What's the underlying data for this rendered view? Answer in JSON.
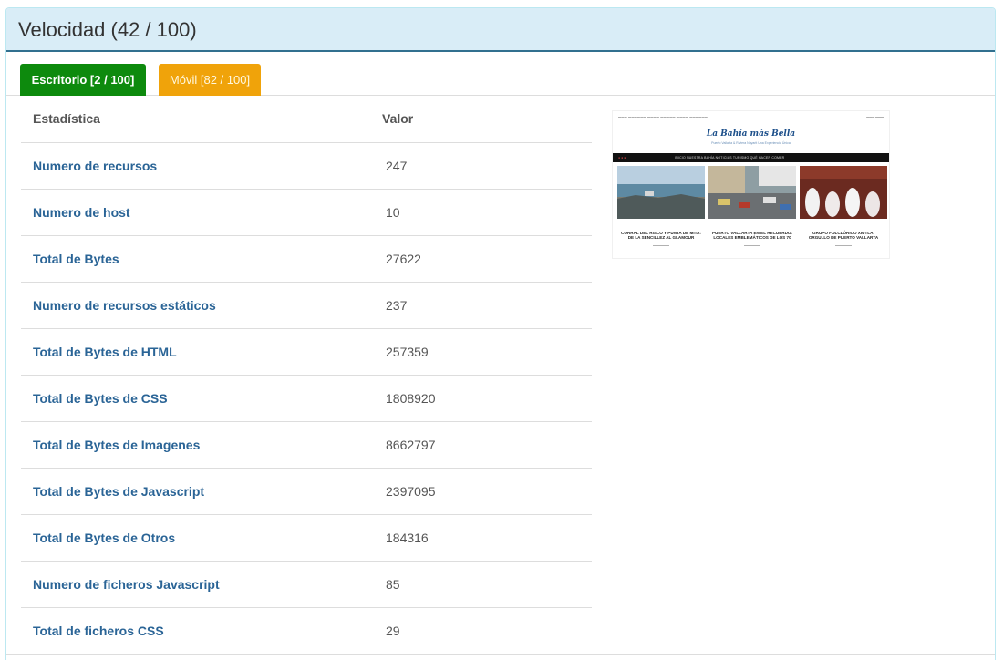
{
  "panel": {
    "title": "Velocidad (42 / 100)"
  },
  "tabs": [
    {
      "label": "Escritorio [2 / 100]"
    },
    {
      "label": "Móvil [82 / 100]"
    }
  ],
  "table": {
    "headers": {
      "stat": "Estadística",
      "value": "Valor"
    },
    "rows": [
      {
        "stat": "Numero de recursos",
        "value": "247"
      },
      {
        "stat": "Numero de host",
        "value": "10"
      },
      {
        "stat": "Total de Bytes",
        "value": "27622"
      },
      {
        "stat": "Numero de recursos estáticos",
        "value": "237"
      },
      {
        "stat": "Total de Bytes de HTML",
        "value": "257359"
      },
      {
        "stat": "Total de Bytes de CSS",
        "value": "1808920"
      },
      {
        "stat": "Total de Bytes de Imagenes",
        "value": "8662797"
      },
      {
        "stat": "Total de Bytes de Javascript",
        "value": "2397095"
      },
      {
        "stat": "Total de Bytes de Otros",
        "value": "184316"
      },
      {
        "stat": "Numero de ficheros Javascript",
        "value": "85"
      },
      {
        "stat": "Total de ficheros CSS",
        "value": "29"
      }
    ]
  },
  "thumbnail": {
    "logo": "La Bahía más Bella",
    "tagline": "Puerto Vallarta & Riviera Nayarit Una Experiencia Única",
    "nav": "INICIO   NUESTRA BAHÍA   NOTICIAS   TURISMO   QUÉ HACER   COMER",
    "cards": [
      {
        "caption": "CORRAL DEL RISCO Y PUNTA DE MITA: DE LA SENCILLEZ AL GLAMOUR"
      },
      {
        "caption": "PUERTO VALLARTA EN EL RECUERDO: LOCALES EMBLEMÁTICOS DE LOS 70"
      },
      {
        "caption": "GRUPO FOLCLÓRICO XIUTLA: ORGULLO DE PUERTO VALLARTA"
      }
    ]
  }
}
